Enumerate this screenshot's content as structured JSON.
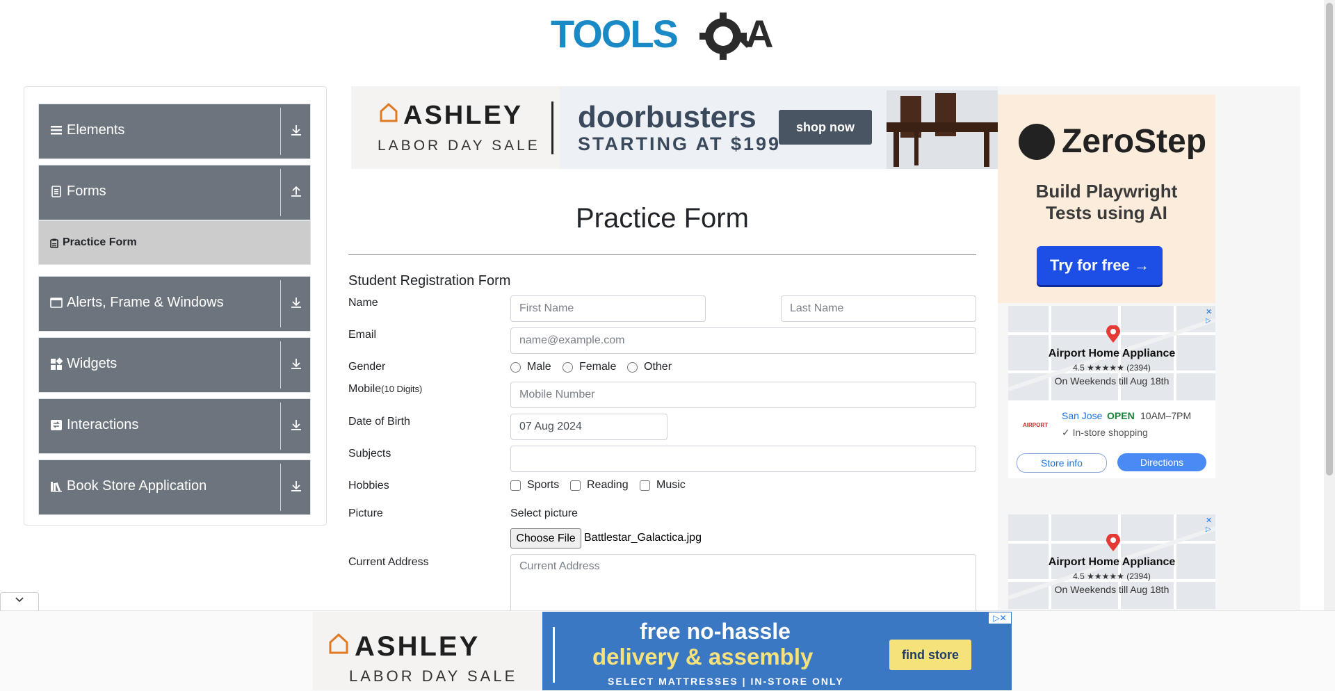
{
  "logo": {
    "brand_text": "TOOLSQA",
    "accent_color": "#1a8ac7"
  },
  "sidebar": {
    "groups": [
      {
        "label": "Elements",
        "icon": "hamburger-icon",
        "arrow": "download-arrow-icon"
      },
      {
        "label": "Forms",
        "icon": "document-icon",
        "arrow": "upload-arrow-icon"
      },
      {
        "label": "Alerts, Frame & Windows",
        "icon": "window-icon",
        "arrow": "download-arrow-icon"
      },
      {
        "label": "Widgets",
        "icon": "widgets-icon",
        "arrow": "download-arrow-icon"
      },
      {
        "label": "Interactions",
        "icon": "interactions-icon",
        "arrow": "download-arrow-icon"
      },
      {
        "label": "Book Store Application",
        "icon": "books-icon",
        "arrow": "download-arrow-icon"
      }
    ],
    "active_item": {
      "label": "Practice Form",
      "icon": "clipboard-icon"
    }
  },
  "top_ad": {
    "brand": "ASHLEY",
    "sub": "LABOR DAY SALE",
    "headline": "doorbusters",
    "subline": "STARTING AT $199",
    "cta": "shop now"
  },
  "zerostep_ad": {
    "brand": "ZeroStep",
    "tagline_1": "Build Playwright",
    "tagline_2": "Tests using AI",
    "cta": "Try for free →"
  },
  "store_ad": {
    "name": "Airport Home Appliance",
    "rating": "4.5 ★★★★★ (2394)",
    "hours_note": "On Weekends till Aug 18th",
    "store_logo": "AIRPORT",
    "city": "San Jose",
    "status": "OPEN",
    "hours": "10AM–7PM",
    "feature": "✓ In-store shopping",
    "btn_info": "Store info",
    "btn_directions": "Directions"
  },
  "form": {
    "page_title": "Practice Form",
    "form_title": "Student Registration Form",
    "labels": {
      "name": "Name",
      "email": "Email",
      "gender": "Gender",
      "mobile": "Mobile",
      "mobile_hint": "(10 Digits)",
      "dob": "Date of Birth",
      "subjects": "Subjects",
      "hobbies": "Hobbies",
      "picture": "Picture",
      "address": "Current Address"
    },
    "placeholders": {
      "first_name": "First Name",
      "last_name": "Last Name",
      "email": "name@example.com",
      "mobile": "Mobile Number",
      "address": "Current Address"
    },
    "dob_value": "07 Aug 2024",
    "gender_options": [
      "Male",
      "Female",
      "Other"
    ],
    "hobby_options": [
      "Sports",
      "Reading",
      "Music"
    ],
    "select_picture": "Select picture",
    "choose_file": "Choose File",
    "file_name": "Battlestar_Galactica.jpg"
  },
  "bottom_ad": {
    "brand": "ASHLEY",
    "sub": "LABOR DAY SALE",
    "line1": "free no-hassle",
    "line2": "delivery & assembly",
    "line3": "SELECT MATTRESSES | IN-STORE ONLY",
    "cta": "find store"
  }
}
